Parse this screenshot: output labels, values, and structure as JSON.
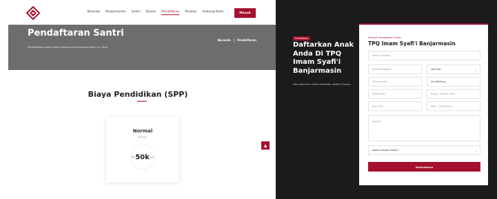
{
  "nav": {
    "links": [
      "Beranda",
      "Pengumuman",
      "Galeri",
      "Donasi",
      "Pendaftaran",
      "Struktur",
      "Hubungi Kami"
    ],
    "active_index": 4,
    "login_label": "Masuk"
  },
  "hero": {
    "title": "Pendaftaran Santri",
    "subtitle": "Pendaftaran santri telah dibuka untuk periode tahun ini. Ikuti",
    "breadcrumb_home": "Beranda",
    "breadcrumb_sep": "|",
    "breadcrumb_current": "Pendaftaran"
  },
  "spp": {
    "title": "Biaya Pendidikan (SPP)",
    "card_title": "Normal",
    "card_subtitle": "Normal",
    "currency": "Rp",
    "price": "50k",
    "period": "/bln"
  },
  "scroll_top_icon": "arrow-up-icon",
  "side": {
    "badge": "Pendaftaran",
    "title": "Daftarkan Anak Anda Di TPQ Imam Syafi'i Banjarmasin",
    "description": "Usia minimum untuk mendaftar adalah 5 tahun."
  },
  "form": {
    "label": "Formulir Pendaftaran Calon",
    "title": "TPQ Imam Syafi'i Banjarmasin",
    "full_name_placeholder": "Nama Lengkap",
    "nickname_placeholder": "Nama Panggilan",
    "gender_value": "Laki-laki",
    "birthplace_placeholder": "Tempat Lahir",
    "birthdate_value": "mm/dd/yyyy",
    "parent_name_placeholder": "Nama Wali",
    "phone_placeholder": "Nomor Telepon Wali",
    "school_placeholder": "Asal Sek...",
    "email_placeholder": "Mail... (ema/alam)",
    "address_placeholder": "Alamat",
    "package_value": "Normal (Rp50.000/bl)",
    "submit_label": "Selanjutnya"
  },
  "colors": {
    "brand": "#a5102f",
    "hero_bg": "#6d6d6d",
    "dark_bg": "#1b1b1b"
  }
}
